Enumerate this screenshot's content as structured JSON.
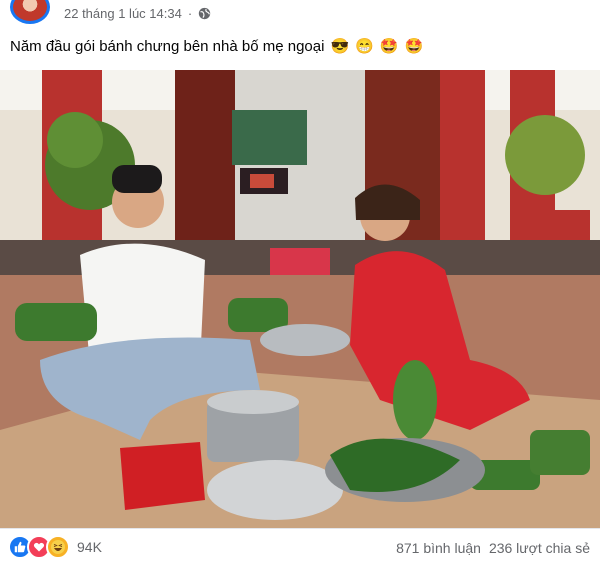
{
  "post": {
    "timestamp": "22 tháng 1 lúc 14:34",
    "separator": "·",
    "caption_text": "Năm đầu gói bánh chưng bên nhà bố mẹ ngoại",
    "caption_emojis": [
      "😎",
      "😁",
      "🤩",
      "🤩"
    ],
    "photo_alt": "Family wrapping bánh chưng on the porch"
  },
  "reactions": {
    "icons": [
      "like-icon",
      "love-icon",
      "haha-icon"
    ],
    "count": "94K"
  },
  "stats": {
    "comments": "871 bình luận",
    "shares": "236 lượt chia sẻ"
  },
  "colors": {
    "accent": "#1877f2",
    "love": "#f33e58",
    "haha": "#f7b125",
    "secondary_text": "#65676b"
  }
}
